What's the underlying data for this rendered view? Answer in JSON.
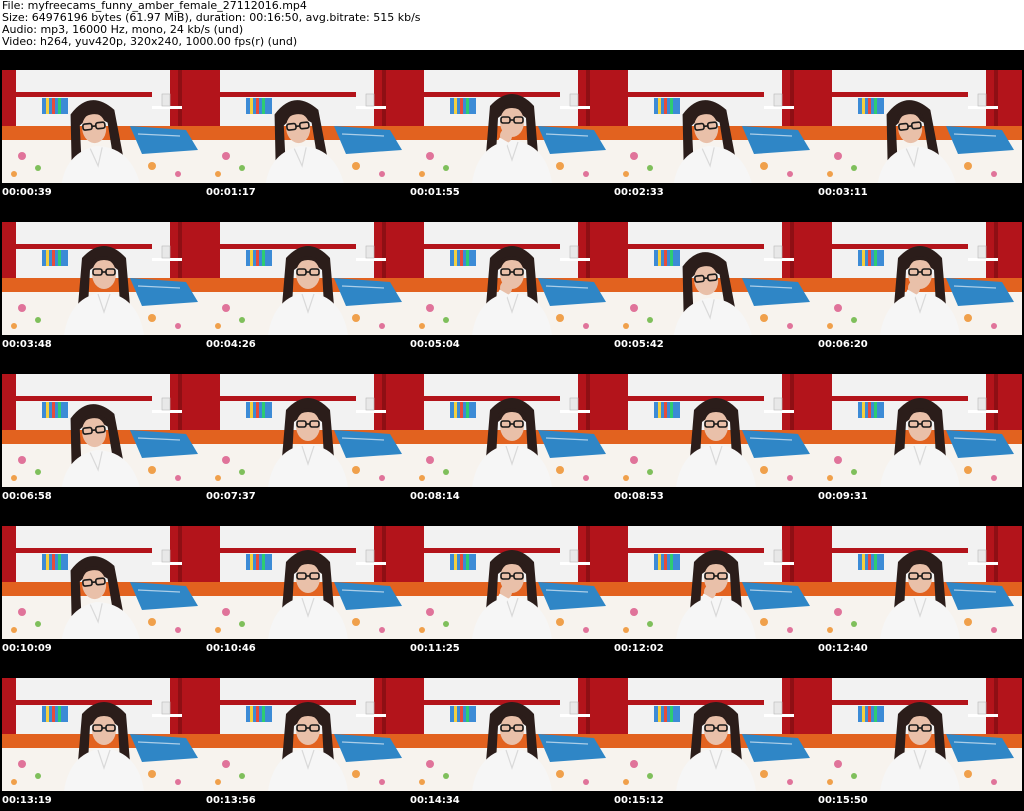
{
  "header": {
    "file_line": "File: myfreecams_funny_amber_female_27112016.mp4",
    "size_line": "Size: 64976196 bytes (61.97 MiB), duration: 00:16:50, avg.bitrate: 515 kb/s",
    "audio_line": "Audio: mp3, 16000 Hz, mono, 24 kb/s (und)",
    "video_line": "Video: h264, yuv420p, 320x240, 1000.00 fps(r) (und)"
  },
  "colors": {
    "sheet_background": "#000000",
    "timestamp_text": "#ffffff",
    "header_text": "#000000",
    "wall": "#f2f2f2",
    "red_panel": "#b3141b",
    "floor_orange": "#e2621f",
    "blanket_blue": "#2f86c6",
    "shirt_white": "#f6f6f6",
    "hair_dark": "#2b1d1a",
    "skin": "#e9c0a9"
  },
  "thumbnails": [
    {
      "timestamp": "00:00:39",
      "pose": "lean"
    },
    {
      "timestamp": "00:01:17",
      "pose": "lean"
    },
    {
      "timestamp": "00:01:55",
      "pose": "hand"
    },
    {
      "timestamp": "00:02:33",
      "pose": "lean"
    },
    {
      "timestamp": "00:03:11",
      "pose": "lean"
    },
    {
      "timestamp": "00:03:48",
      "pose": "sit"
    },
    {
      "timestamp": "00:04:26",
      "pose": "sit"
    },
    {
      "timestamp": "00:05:04",
      "pose": "hand"
    },
    {
      "timestamp": "00:05:42",
      "pose": "lean"
    },
    {
      "timestamp": "00:06:20",
      "pose": "hand"
    },
    {
      "timestamp": "00:06:58",
      "pose": "lean"
    },
    {
      "timestamp": "00:07:37",
      "pose": "sit"
    },
    {
      "timestamp": "00:08:14",
      "pose": "sit"
    },
    {
      "timestamp": "00:08:53",
      "pose": "sit"
    },
    {
      "timestamp": "00:09:31",
      "pose": "sit"
    },
    {
      "timestamp": "00:10:09",
      "pose": "lean"
    },
    {
      "timestamp": "00:10:46",
      "pose": "sit"
    },
    {
      "timestamp": "00:11:25",
      "pose": "hand"
    },
    {
      "timestamp": "00:12:02",
      "pose": "hand"
    },
    {
      "timestamp": "00:12:40",
      "pose": "sit"
    },
    {
      "timestamp": "00:13:19",
      "pose": "sit"
    },
    {
      "timestamp": "00:13:56",
      "pose": "sit"
    },
    {
      "timestamp": "00:14:34",
      "pose": "sit"
    },
    {
      "timestamp": "00:15:12",
      "pose": "sit"
    },
    {
      "timestamp": "00:15:50",
      "pose": "sit"
    }
  ]
}
